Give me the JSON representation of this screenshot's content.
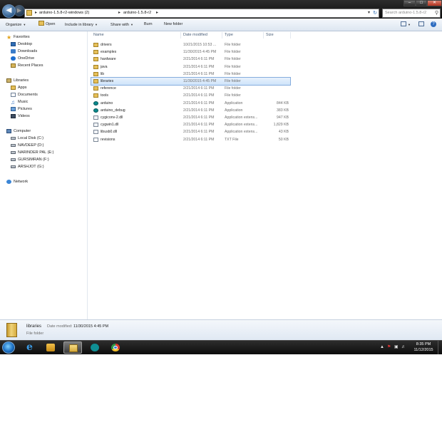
{
  "address_bar": {
    "breadcrumbs": [
      "arduino-1.5.8-r2-windows (2)",
      "arduino-1.5.8-r2"
    ],
    "search_placeholder": "Search arduino-1.5.8-r2"
  },
  "toolbar": {
    "organize": "Organize",
    "open": "Open",
    "include_in_library": "Include in library",
    "share_with": "Share with",
    "burn": "Burn",
    "new_folder": "New folder"
  },
  "nav_pane": {
    "favorites": {
      "label": "Favorites",
      "items": [
        "Desktop",
        "Downloads",
        "OneDrive",
        "Recent Places"
      ]
    },
    "libraries": {
      "label": "Libraries",
      "items": [
        "Apps",
        "Documents",
        "Music",
        "Pictures",
        "Videos"
      ]
    },
    "computer": {
      "label": "Computer",
      "items": [
        "Local Disk (C:)",
        "NAVDEEP (D:)",
        "NARINDER PAL (E:)",
        "GURSIMRAN (F:)",
        "ARSHJOT (G:)"
      ]
    },
    "network": {
      "label": "Network"
    }
  },
  "columns": {
    "name": "Name",
    "date_modified": "Date modified",
    "type": "Type",
    "size": "Size"
  },
  "files": [
    {
      "name": "drivers",
      "date": "10/21/2015 10:53 ...",
      "type": "File folder",
      "size": "",
      "icon": "folder",
      "selected": false
    },
    {
      "name": "examples",
      "date": "11/30/2015 4:45 PM",
      "type": "File folder",
      "size": "",
      "icon": "folder",
      "selected": false
    },
    {
      "name": "hardware",
      "date": "2/21/2014 6:11 PM",
      "type": "File folder",
      "size": "",
      "icon": "folder",
      "selected": false
    },
    {
      "name": "java",
      "date": "2/21/2014 6:11 PM",
      "type": "File folder",
      "size": "",
      "icon": "folder",
      "selected": false
    },
    {
      "name": "lib",
      "date": "2/21/2014 6:11 PM",
      "type": "File folder",
      "size": "",
      "icon": "folder",
      "selected": false
    },
    {
      "name": "libraries",
      "date": "11/30/2015 4:45 PM",
      "type": "File folder",
      "size": "",
      "icon": "folder",
      "selected": true
    },
    {
      "name": "reference",
      "date": "2/21/2014 6:11 PM",
      "type": "File folder",
      "size": "",
      "icon": "folder",
      "selected": false
    },
    {
      "name": "tools",
      "date": "2/21/2014 6:11 PM",
      "type": "File folder",
      "size": "",
      "icon": "folder",
      "selected": false
    },
    {
      "name": "arduino",
      "date": "2/21/2014 6:11 PM",
      "type": "Application",
      "size": "844 KB",
      "icon": "app",
      "selected": false
    },
    {
      "name": "arduino_debug",
      "date": "2/21/2014 6:11 PM",
      "type": "Application",
      "size": "383 KB",
      "icon": "app",
      "selected": false
    },
    {
      "name": "cygiconv-2.dll",
      "date": "2/21/2014 6:11 PM",
      "type": "Application extens...",
      "size": "947 KB",
      "icon": "dll",
      "selected": false
    },
    {
      "name": "cygwin1.dll",
      "date": "2/21/2014 6:11 PM",
      "type": "Application extens...",
      "size": "1,829 KB",
      "icon": "dll",
      "selected": false
    },
    {
      "name": "libusb0.dll",
      "date": "2/21/2014 6:11 PM",
      "type": "Application extens...",
      "size": "43 KB",
      "icon": "dll",
      "selected": false
    },
    {
      "name": "revisions",
      "date": "2/21/2014 6:11 PM",
      "type": "TXT File",
      "size": "50 KB",
      "icon": "txt",
      "selected": false
    }
  ],
  "details_pane": {
    "name": "libraries",
    "date_modified_label": "Date modified:",
    "date_modified": "11/30/2015 4:45 PM",
    "type": "File folder"
  },
  "taskbar": {
    "apps": [
      "internet-explorer-icon",
      "media-player-icon",
      "windows-explorer-icon",
      "arduino-icon",
      "chrome-icon"
    ],
    "active_app": "windows-explorer-icon",
    "clock_time": "8:35 PM",
    "clock_date": "11/12/2015"
  },
  "colors": {
    "selection_fill": "#cfe4fa",
    "selection_border": "#84acdd",
    "taskbar": "#1a1a1a",
    "folder": "#e6c05a"
  }
}
